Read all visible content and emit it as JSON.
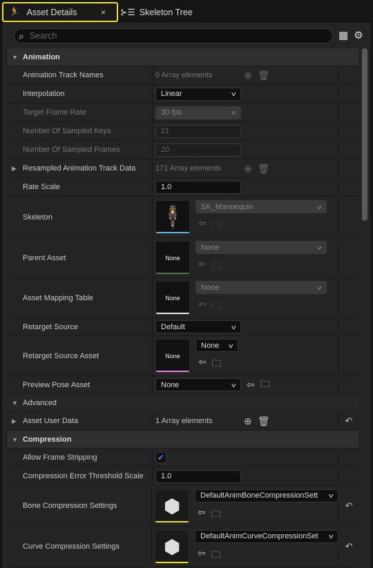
{
  "tabs": [
    {
      "label": "Asset Details",
      "close": "×"
    },
    {
      "label": "Skeleton Tree"
    }
  ],
  "search": {
    "placeholder": "Search"
  },
  "rows": [
    {
      "t": "cat",
      "label": "Animation"
    },
    {
      "t": "arr",
      "label": "Animation Track Names",
      "value": "0 Array elements",
      "gray": true,
      "h": 27
    },
    {
      "t": "dd",
      "label": "Interpolation",
      "value": "Linear",
      "h": 27
    },
    {
      "t": "dd",
      "label": "Target Frame Rate",
      "value": "30 fps",
      "dis": true,
      "h": 27
    },
    {
      "t": "num",
      "label": "Number Of Sampled Keys",
      "value": "21",
      "dis": true,
      "h": 27
    },
    {
      "t": "num",
      "label": "Number Of Sampled Frames",
      "value": "20",
      "dis": true,
      "h": 27
    },
    {
      "t": "arr",
      "label": "Resampled Animation Track Data",
      "value": "171 Array elements",
      "gray": true,
      "exp": true,
      "h": 27
    },
    {
      "t": "num",
      "label": "Rate Scale",
      "value": "1.0",
      "h": 27
    },
    {
      "t": "asset",
      "label": "Skeleton",
      "value": "SK_Mannequin",
      "thumb": "",
      "bar": "#5ab8d8",
      "dis": true,
      "h": 60
    },
    {
      "t": "asset",
      "label": "Parent Asset",
      "value": "None",
      "thumb": "None",
      "bar": "#4a7a44",
      "dis": true,
      "h": 58
    },
    {
      "t": "asset",
      "label": "Asset Mapping Table",
      "value": "None",
      "thumb": "None",
      "bar": "#eeeeee",
      "dis": true,
      "h": 58
    },
    {
      "t": "dd",
      "label": "Retarget Source",
      "value": "Default",
      "h": 26
    },
    {
      "t": "asset",
      "label": "Retarget Source Asset",
      "value": "None",
      "thumb": "None",
      "bar": "#e080e0",
      "small": true,
      "h": 58
    },
    {
      "t": "inline",
      "label": "Preview Pose Asset",
      "value": "None",
      "h": 26
    },
    {
      "t": "cat",
      "label": "Advanced",
      "plain": true
    },
    {
      "t": "arr",
      "label": "Asset User Data",
      "value": "1 Array elements",
      "exp": true,
      "reset": true,
      "h": 27
    },
    {
      "t": "cat",
      "label": "Compression"
    },
    {
      "t": "chk",
      "label": "Allow Frame Stripping",
      "value": "✔",
      "h": 27
    },
    {
      "t": "num",
      "label": "Compression Error Threshold Scale",
      "value": "1.0",
      "h": 27
    },
    {
      "t": "asset",
      "label": "Bone Compression Settings",
      "value": "DefaultAnimBoneCompressionSett",
      "thumb": "cube",
      "bar": "#e8e020",
      "wide": true,
      "reset": true,
      "h": 59
    },
    {
      "t": "asset",
      "label": "Curve Compression Settings",
      "value": "DefaultAnimCurveCompressionSet",
      "thumb": "cube",
      "bar": "#e8e020",
      "wide": true,
      "reset": true,
      "h": 59
    }
  ]
}
